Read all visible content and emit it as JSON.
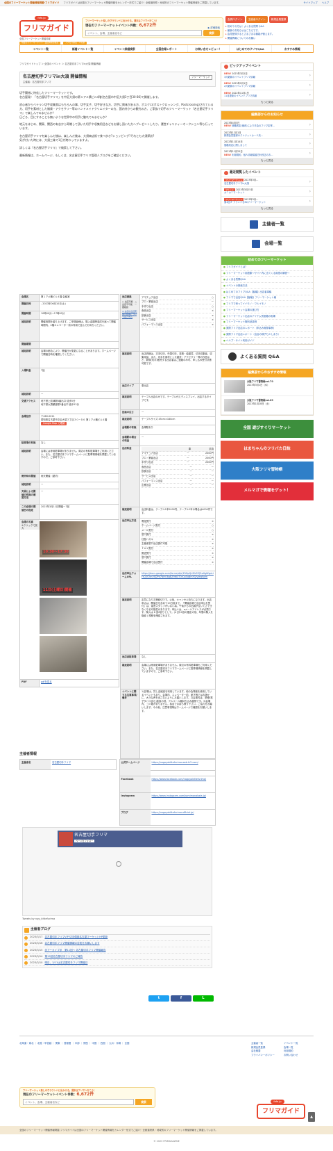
{
  "topbar": {
    "site": "全国のフリーマーケット開催情報掲載-フリマガイド",
    "desc": "フリマガイドは全国のフリーマーケット開催情報をカレンダー形式でご紹介！全都道府県・地域別のフリーマーケット開催情報をご掲載しています。",
    "links": [
      "サイトマップ",
      "ヘルプ"
    ]
  },
  "header": {
    "logo_tag": "fefe.jp",
    "logo_text": "フリマガイド",
    "logo_sub": "全国フリーマーケット開催情報",
    "search_caption": "フリーマーケット探しのヴラウンドに出かける。週末はフリマへ行こう！",
    "count_label": "現在のフリーマーケットイベント件数：",
    "count_value": "6,672件",
    "detail_link": "▶ 詳細検索",
    "search_placeholder": "イベント、会場、主催者名など",
    "search_button": "検索",
    "buttons": [
      "会員ログイン",
      "主催者ログイン",
      "新規会員登録"
    ],
    "links": [
      "初めての方は｜よくある質問 Q&A",
      "最新のお知らせはこちらです。",
      "会員登録するとさまざまな機能が使えます。",
      "開催情報についてのお願い"
    ]
  },
  "nav": {
    "tags": [
      "現在のフリーマーケット・出店情報を確認",
      "アクセス順位・人気順"
    ],
    "items": [
      "イベント一覧",
      "新着イベント一覧",
      "イベント詳細検索",
      "全国会場レポート",
      "お問い合せレビュー！",
      "はじめてのフリマQ&A",
      "おすすめ情報"
    ]
  },
  "breadcrumb": "フリマガイドトップ ＞ 全国のイベント ＞ 名古屋切手フリマin大須 開催情報",
  "event": {
    "title": "名古屋切手フリマin大須 開催情報",
    "organizer_line": "主催者：名古屋切手フリマ",
    "type_tag": "フリーマーケット",
    "intro": [
      "切手関係に特化したフリーマーケットです。",
      "名古屋発！「名古屋切手フリマ」を中区大須の第１アメ横ビル4階(名古屋市中区大須3丁目30-86)で開催します。",
      "初心者からベテラン切手収集家はもちろんの事、切手女子、切手好きな方、切手に興味がある方、ポスクロ(ポストクロッシング、Postcrossing)されている方、切手を素材とした雑貨・アクセサリー等のハンドメイドクリエイターの方、国内外からの観光の方、ご家族で切手のフリーマーケット『名古屋切手フリマ』で楽しんでみませんか？",
      "日ごろ、目にすることも無いような世界中の切手に触れてみませんか？",
      "地元をはじめ、関東、関西の有志から寄贈して頂いた切手や収集用品などをお譲し頂いた方へプレゼントしたり、運営チャリティーオークション等も行っています。",
      "名古屋切手フリマを楽しんだ後は、楽しんだ後は、大須商店街で食べ歩き?ショッピング?それとも大須探訪?",
      "気が付いた時には、大須三昧で1日が終わっていますよ。",
      "詳しくは『名古屋切手フリマ』で検索して下さい。",
      "最新情報は、ホームページ、もしくは、名古屋切手フリマ管理人ブログをご確認ください。"
    ]
  },
  "details_left": [
    {
      "k": "会場名",
      "v": "第１アメ横ビル４階 会議室"
    },
    {
      "k": "開催日時",
      "v": "- 2023年06月10日(土)"
    },
    {
      "k": "開催時間",
      "v": "10時00分〜17時00分"
    },
    {
      "k": "補足説明",
      "v": "開催時間を繰り上げます。ご来場者様は、購入金額等達成を迷って開催時間内、4階エレベーター前の専用で並んでお待ちください。"
    },
    {
      "k": "開催期間",
      "v": ""
    },
    {
      "k": "補足説明",
      "v": "会場の都合により、開催日が変更になることがあります。ホームページで開催日時を確認してください。"
    },
    {
      "k": "入場料金",
      "v": "7話"
    },
    {
      "k": "補足説明",
      "v": "ー"
    },
    {
      "k": "交通アクセス",
      "v": "地下鉄上前津駅8番出口 徒歩5分\n地下鉄大須観音駅2番出口 徒歩12分"
    },
    {
      "k": "会場住所",
      "v": "〒460-0011\n愛知県名古屋市中区大須３丁目３０−８６ 第１アメ横ビル４階"
    },
    {
      "k": "駐車場の有無",
      "v": "なし"
    },
    {
      "k": "補足説明",
      "v": "会場には専用駐車場がありません。周辺の有料駐車場をご利用ください。また、名古屋切手フリマホームページに駐車場情報を掲載していますので、ご参考下さい。"
    },
    {
      "k": "雨天時の開催",
      "v": "雨天開催（屋内）"
    },
    {
      "k": "補足説明",
      "v": "ー"
    },
    {
      "k": "天候による開催の有無の確認方法",
      "v": "ー"
    },
    {
      "k": "この会場の開催日の指定",
      "v": "2023年3月11日開催ー7回"
    },
    {
      "k": "会場の写真",
      "v": ""
    },
    {
      "k": "PDF",
      "v": "pdfを見る"
    }
  ],
  "photo_note": "※クリックで拡大",
  "photo_captions": [
    "10:30〜17:30",
    "11日(土曜日)開催",
    "",
    ""
  ],
  "google_map_button": "Google Map で確認",
  "details_right": {
    "exhibit_k": "出店資格",
    "exhibit_rows": [
      [
        "アマチュア出店",
        "○"
      ],
      [
        "プロ・業者出店",
        "ー"
      ],
      [
        "手作り出店",
        "○"
      ],
      [
        "食品出店",
        "×"
      ],
      [
        "飲食出店",
        "×"
      ],
      [
        "サービス出店",
        "×"
      ],
      [
        "パフォーマンス出店",
        "×"
      ]
    ],
    "exhibit_note": "○ 出店可能　△ 出店不可能　ー 要相談",
    "exhibit_link": "※ お店の出店形態の説明についてはこちら",
    "notes": [
      {
        "k": "補足説明",
        "v": "出店資格は、古本切手、外国切手、事務・絵葉書、切手収集者、収集用品、また、切手を素材とした雑貨・アクセサリー等の作品など、新規(切手)販売する出店者はご連絡のみ可、申し込み受付次第可能です。"
      },
      {
        "k": "出店タイプ",
        "v": "車出店"
      },
      {
        "k": "補足説明",
        "v": "テーブル出店のみです。テーブル代とディスプレイ、出店するタイプです。"
      },
      {
        "k": "区画の広さ",
        "v": "ー"
      },
      {
        "k": "補足説明",
        "v": "テーブルサイズ 45cm×180cm"
      },
      {
        "k": "会場駅の有無",
        "v": "会場駅あり"
      },
      {
        "k": "会場駅の場合の料金",
        "v": "ー"
      }
    ],
    "fee_k": "出店料金",
    "fee_header": [
      "",
      "車",
      "手持"
    ],
    "fee_rows": [
      [
        "アマチュア出店",
        "ー",
        "2000円"
      ],
      [
        "プロ・業者出店",
        "ー",
        "2000円"
      ],
      [
        "手作り出店",
        "ー",
        "2000円"
      ],
      [
        "食品出店",
        "ー",
        "ー"
      ],
      [
        "飲食出店",
        "ー",
        "ー"
      ],
      [
        "サービス出店",
        "ー",
        "ー"
      ],
      [
        "パフォーマンス出店",
        "ー",
        "ー"
      ],
      [
        "企業出店",
        "ー",
        "ー"
      ]
    ],
    "fee_note": "出店料金は、テーブル1本2000円、テーブル2本の場合は4000円です。",
    "apply_k": "出店申込方法",
    "apply_rows": [
      [
        "電話受付",
        "×"
      ],
      [
        "ホームページ受付",
        "○"
      ],
      [
        "メール受付",
        "○"
      ],
      [
        "窓口受付",
        "×"
      ],
      [
        "往復ハガキ",
        "×"
      ],
      [
        "主催者窓口出店受付可能",
        "×"
      ],
      [
        "ＦＡＸ受付",
        "×"
      ],
      [
        "郵送受付",
        "×"
      ],
      [
        "窓口受付",
        "×"
      ],
      [
        "開催会場で出店受付",
        "×"
      ]
    ],
    "form_k": "出店申込フォームURL",
    "form_url": "https://docs.google.com/forms/d/e/1FAIpQLSfcEfQ5oHgtKgvLiFrQ3Y2mVSDPd7NHO8qBZ9WXT0rCaEqNmYQ/viewform",
    "form_note_k": "補足説明",
    "form_note": "定員になり次第締切です。以後、キャンセル待ちになります。出店申込は、開催日を含めて10日前まで。「開催会場で出店申込を受付」は、運営スタッフがいない為、午後からの出展が空いてさできなくなる可能性があります。申込人は、eメールアドレスが必須です。購入は 6 割8割りとして。(4 割10割の鑑定の他、年間の購入を取締 ) 規程を確認されます。",
    "parking_k": "出店者駐車場",
    "parking_v": "なし",
    "parking_note_k": "補足説明",
    "parking_note": "会場には専用駐車場がありません。周辺の有料駐車場をご利用ください。また、名古屋切手フリマホームページに駐車場情報を掲載していますので、ご参考下さい。",
    "notice_k": "イベントに関する注意事項/備考",
    "notice": "1)会場は、貸し会議室を利用しています。他の会場者を使用しているイベントもあり、会場内、エレベーター前、廊下等ではお静かに、大きな声を出さないようにお願いします。2)会場内は、禁煙(電子タバコ含む)飲食の他、アルコール類持ち込み厳禁です。3)会場内、ゴミ箱がありません。各自でお持ち帰り下さい。ご協力をお願いします。その他、注意事項等はホームページで確認をお願いします。",
    "same_k": "同時開催のイベント",
    "same_v": "なし"
  },
  "organizer": {
    "heading": "主催者情報",
    "name_k": "主催者名",
    "name_v": "名古屋切手フリマ",
    "rows": [
      {
        "k": "公式ホームページ",
        "v": "https://nagoyakittefurima.web.fc2.com/"
      },
      {
        "k": "Facebook",
        "v": "https://www.facebook.com/nagoyakittefurima/"
      },
      {
        "k": "Instagram",
        "v": "https://www.instagram.com/kamimanakata.jp/"
      },
      {
        "k": "ブログ",
        "v": "https://nagoyakittefurima.official.jp/"
      }
    ]
  },
  "twitter_widget": {
    "page_name": "名古屋切手フリマ",
    "follow": "ページをフォロー",
    "tweets_by": "Tweets by ngy_kittefurima"
  },
  "blog": {
    "heading": "主催者ブログ",
    "items": [
      {
        "date": "2023/3/17",
        "text": "名古屋切手フリマVIP 切手倶楽名古屋マーケットHP更新"
      },
      {
        "date": "2023/3/16",
        "text": "名古屋切手フリマ開催情報の告知をお願いします"
      },
      {
        "date": "2023/3/15",
        "text": "＠アーカイブ＠　第11回～ 名古屋切手フリマ開催報告"
      },
      {
        "date": "2023/3/14",
        "text": "第15回名古屋切手フリマのご報告"
      },
      {
        "date": "2023/3/10",
        "text": "明日、3/11は名古屋切手フリマ開催日"
      }
    ]
  },
  "share": {
    "twitter": "t",
    "facebook": "f",
    "line": "L"
  },
  "side": {
    "pickup_title": "ピックアップイベント",
    "pickup": [
      {
        "tag": "NEW!",
        "date": "2023年3月1日",
        "text": "3月更新のイベントフリマ情報"
      },
      {
        "tag": "NEW!",
        "date": "2023年2月1日",
        "text": "2月更新のイベントフリマ情報"
      },
      {
        "tag": "NEW!",
        "date": "2022年11月1日",
        "text": "11月更新のイベントフリマ情報"
      }
    ],
    "more": "もっと見る",
    "notice_title": "編集部からのお知らせ",
    "notices": [
      {
        "date": "2023年4月5日",
        "tag": "NEW!",
        "text": "価格改定(値改)により半会のフリマ定率…"
      },
      {
        "date": "2022年12月1日",
        "tag": "",
        "text": "新規会員登録のクレジットカード決…"
      },
      {
        "date": "2022年11月14日",
        "tag": "",
        "text": "価格改定に関しまして"
      },
      {
        "date": "2021年11月25日",
        "tag": "NEW!",
        "text": "利用規約、個人情報保護方針改正のお…"
      }
    ],
    "recent_title": "最近閲覧したイベント",
    "recent": [
      {
        "tag": "フリーマーケット",
        "date": "2023年3月…",
        "text": "名古屋切手フリマin大須"
      },
      {
        "tag": "マルシェ",
        "date": "2023年3月25日",
        "text": "カニカニマーケット"
      },
      {
        "tag": "フリーマーケット",
        "date": "2023年3月…",
        "text": "第4回ギ ブランドを80フリーマーケット"
      }
    ],
    "btn_org": "主催者一覧",
    "btn_venue": "会場一覧",
    "first_title": "初めてのフリーマーケット",
    "first_links": [
      "フリマガイドとは？",
      "フリーマーケット用語集〜サイト内に出てくる用語の解説〜",
      "よくある質問Q&A",
      "イベントの検索方法",
      "はじめてのフリマQ&A【客編】出店者事編",
      "フリマで出店Q&A【客編】フリーマーケット編",
      "フリマで売ってイイモノ・ワルイモノ",
      "フリーマーケット会場の選び方",
      "フリーマーケット出店のアイテム別価格の相場",
      "フリーマーケット戦利品事例",
      "実際フリマ出店のレポート（申込み実際事例）",
      "実際フリマ出店レポート（出店の様子も少しあり）",
      "ヘルプ・サイト利用ガイド"
    ],
    "qa": "よくある質問 Q&A",
    "recommend_title": "編集部からのおすすめ情報",
    "mags": [
      {
        "title": "大阪フリマ冒物帳vol.70",
        "date": "2023年3月1日（水）"
      },
      {
        "title": "大阪フリマ冒物帳vol.69",
        "date": "2023年1月28日（土）"
      }
    ],
    "banners": [
      "全国 遊びすぐりマーケット",
      "はまちゃんのフリバカ日誌",
      "大阪フリマ冒物帳",
      "メルマガで情報をゲット！"
    ]
  },
  "footer": {
    "areas": "北海道・東北 ｜ 北陸・甲信越 ｜ 関東 ｜ 首都圏 ｜ 中部 ｜ 関西 ｜ 中国 ｜ 四国 ｜ 九州・沖縄 ｜ 全国",
    "links": [
      "主催者一覧",
      "イベント一覧",
      "新規会員登録",
      "会場一覧",
      "会社概要",
      "利用規約",
      "プライバシーポリシー",
      "お問い合わせ"
    ],
    "search_caption": "フリーマーケット探しのヴラウンドに出かける。週末はフリマへ行こう！",
    "count_label": "現在のフリーマーケットイベント件数：",
    "count_value": "6,672件",
    "search_placeholder": "イベント、会場、主催者名など",
    "search_button": "検索",
    "logo_tag": "fefe.jp",
    "logo_text": "フリマガイド",
    "bar": "全国のフリーマーケット開催情報掲載-フリマガイドは全国のフリーマーケット開催情報をカレンダー形式でご紹介！全都道府県・地域別のフリーマーケット開催情報をご掲載しています。",
    "copyright": "© 2023 FRIMAGAZINE"
  }
}
